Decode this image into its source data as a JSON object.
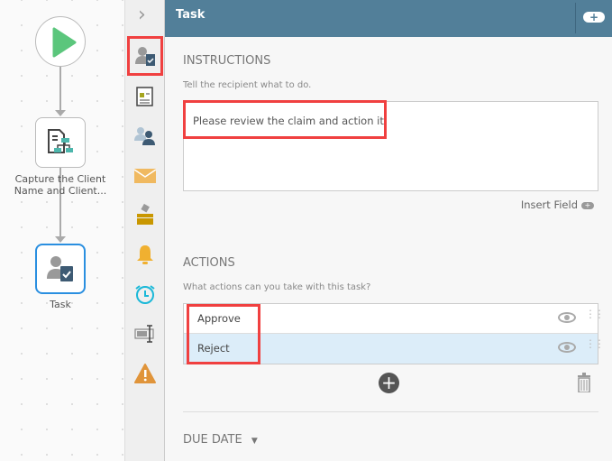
{
  "canvas": {
    "nodes": [
      {
        "label": "Capture the Client Name and Client..."
      },
      {
        "label": "Task"
      }
    ]
  },
  "toolbox": {
    "collapse": "›",
    "tools": [
      "task-icon",
      "form-icon",
      "users-icon",
      "email-icon",
      "box-icon",
      "notification-icon",
      "timer-icon",
      "field-icon",
      "warning-icon"
    ]
  },
  "panel": {
    "title": "Task",
    "instructions": {
      "heading": "INSTRUCTIONS",
      "hint": "Tell the recipient what to do.",
      "value": "Please review the claim and action it",
      "insert_field": "Insert Field"
    },
    "actions": {
      "heading": "ACTIONS",
      "hint": "What actions can you take with this task?",
      "items": [
        "Approve",
        "Reject"
      ],
      "add": "+"
    },
    "due_date": {
      "heading": "DUE DATE",
      "toggle": "▼"
    }
  },
  "colors": {
    "header": "#527f99",
    "highlight": "#f04040",
    "selected": "#2a8fe0"
  }
}
